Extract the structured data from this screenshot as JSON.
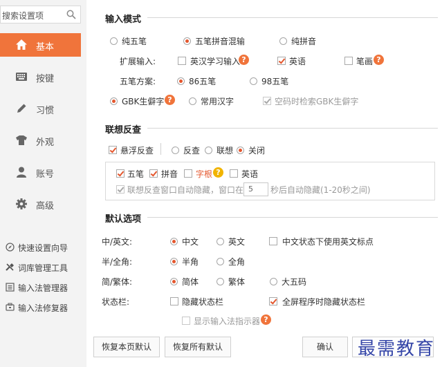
{
  "sidebar": {
    "search_placeholder": "搜索设置项",
    "nav": [
      {
        "label": "基本",
        "icon": "home-icon",
        "active": true
      },
      {
        "label": "按键",
        "icon": "keyboard-icon",
        "active": false
      },
      {
        "label": "习惯",
        "icon": "pencil-icon",
        "active": false
      },
      {
        "label": "外观",
        "icon": "shirt-icon",
        "active": false
      },
      {
        "label": "账号",
        "icon": "user-icon",
        "active": false
      },
      {
        "label": "高级",
        "icon": "gear-icon",
        "active": false
      }
    ],
    "tools": [
      {
        "label": "快速设置向导",
        "icon": "compass-icon"
      },
      {
        "label": "词库管理工具",
        "icon": "wrench-icon"
      },
      {
        "label": "输入法管理器",
        "icon": "list-icon"
      },
      {
        "label": "输入法修复器",
        "icon": "repair-icon"
      }
    ]
  },
  "input_mode": {
    "title": "输入模式",
    "modes": [
      "纯五笔",
      "五笔拼音混输",
      "纯拼音"
    ],
    "selected_mode": "五笔拼音混输",
    "extend_label": "扩展输入:",
    "extend": [
      {
        "label": "英汉学习输入",
        "checked": false
      },
      {
        "label": "英语",
        "checked": true
      },
      {
        "label": "笔画",
        "checked": false
      }
    ],
    "scheme_label": "五笔方案:",
    "schemes": [
      "86五笔",
      "98五笔"
    ],
    "selected_scheme": "86五笔",
    "charsets": [
      "GBK生僻字",
      "常用汉字"
    ],
    "selected_charset": "GBK生僻字",
    "empty_code_label": "空码时检索GBK生僻字",
    "empty_code_checked": true
  },
  "reverse_lookup": {
    "title": "联想反查",
    "float_label": "悬浮反查",
    "float_checked": true,
    "options": [
      "反查",
      "联想",
      "关闭"
    ],
    "selected_option": "关闭",
    "sub": [
      {
        "label": "五笔",
        "checked": true
      },
      {
        "label": "拼音",
        "checked": true
      },
      {
        "label": "字根",
        "checked": false
      },
      {
        "label": "英语",
        "checked": false
      }
    ],
    "autohide_prefix": "联想反查窗口自动隐藏，窗口在",
    "autohide_value": "5",
    "autohide_suffix": "秒后自动隐藏(1-20秒之间)",
    "autohide_checked": true
  },
  "defaults": {
    "title": "默认选项",
    "cn_en_label": "中/英文:",
    "cn_en": [
      "中文",
      "英文"
    ],
    "cn_en_selected": "中文",
    "cn_en_punct_label": "中文状态下使用英文标点",
    "cn_en_punct_checked": false,
    "width_label": "半/全角:",
    "width": [
      "半角",
      "全角"
    ],
    "width_selected": "半角",
    "script_label": "简/繁体:",
    "script": [
      "简体",
      "繁体",
      "大五码"
    ],
    "script_selected": "简体",
    "status_label": "状态栏:",
    "hide_status_label": "隐藏状态栏",
    "hide_status_checked": false,
    "fullscreen_hide_label": "全屏程序时隐藏状态栏",
    "fullscreen_hide_checked": true,
    "show_indicator_label": "显示输入法指示器",
    "show_indicator_checked": false
  },
  "footer": {
    "restore_page": "恢复本页默认",
    "restore_all": "恢复所有默认",
    "ok": "确认",
    "watermark": "最需教育"
  },
  "colors": {
    "accent": "#f0743b",
    "radio_dot": "#e4572e",
    "help_orange": "#f0743b",
    "help_yellow": "#f1b400",
    "sidebar_bg": "#f3f3f3"
  }
}
